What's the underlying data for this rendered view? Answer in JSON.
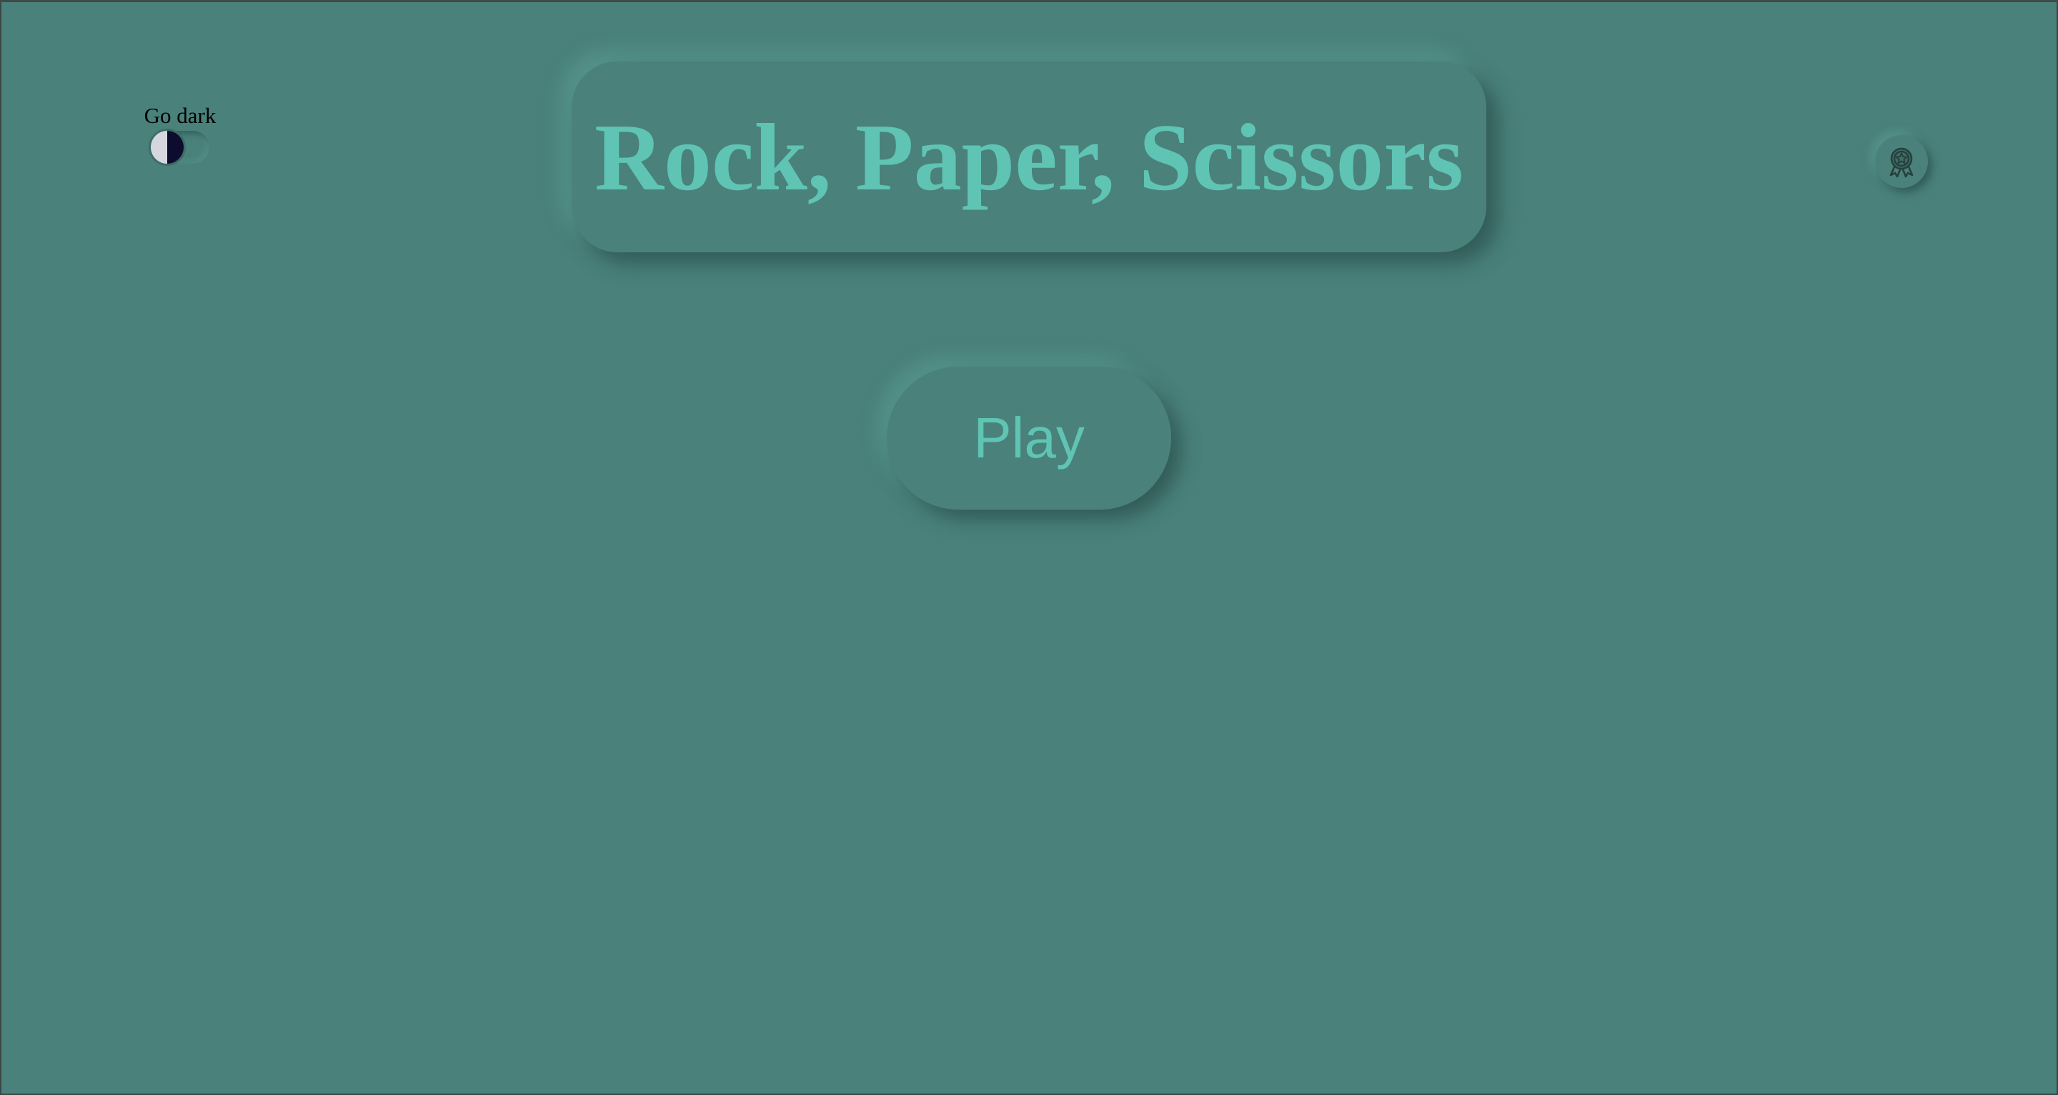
{
  "app": {
    "title": "Rock, Paper, Scissors"
  },
  "theme_toggle": {
    "label": "Go dark",
    "state": "off",
    "icon": "half-moon-contrast-icon"
  },
  "actions": {
    "play_label": "Play"
  },
  "header_right": {
    "icon": "award-badge-icon"
  },
  "colors": {
    "background": "#4a817b",
    "accent": "#5fc4b4",
    "label_text": "#000000"
  }
}
